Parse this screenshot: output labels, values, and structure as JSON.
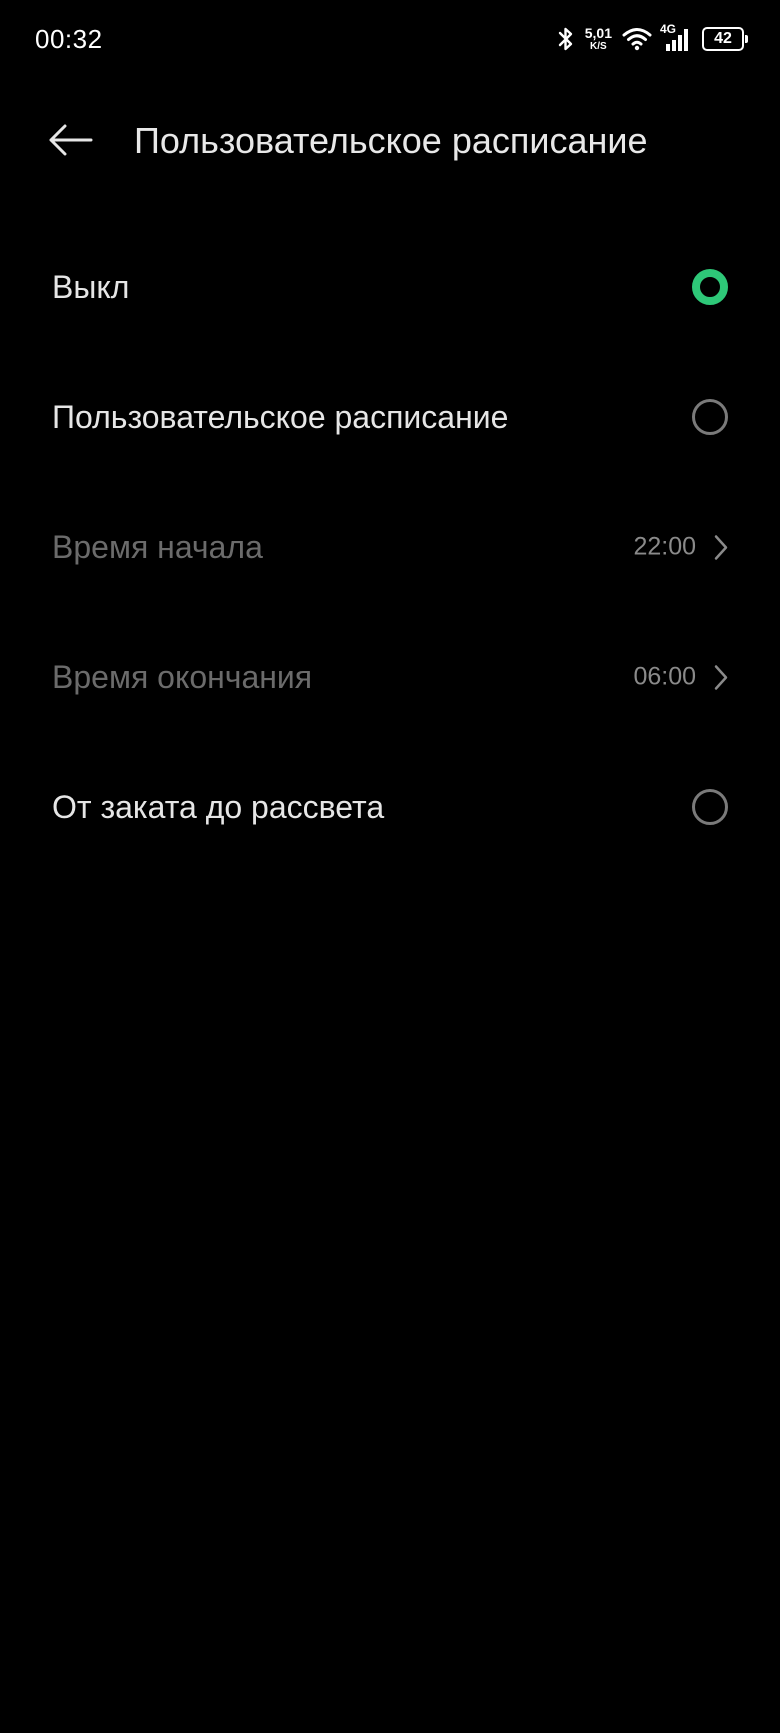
{
  "status_bar": {
    "time": "00:32",
    "net_speed_value": "5,01",
    "net_speed_unit": "K/S",
    "network_type": "4G",
    "battery_level": "42",
    "icons": [
      "bluetooth-icon",
      "wifi-icon",
      "cellular-signal-icon",
      "battery-icon"
    ]
  },
  "header": {
    "title": "Пользовательское расписание",
    "back_icon": "arrow-left-icon"
  },
  "options": {
    "off_label": "Выкл",
    "custom_label": "Пользовательское расписание",
    "start_label": "Время начала",
    "start_value": "22:00",
    "end_label": "Время окончания",
    "end_value": "06:00",
    "sunset_label": "От заката до рассвета",
    "selected": "off"
  },
  "colors": {
    "accent": "#2ec878",
    "background": "#000000",
    "text_primary": "#e6e6e6",
    "text_disabled": "#6b6b6b"
  }
}
